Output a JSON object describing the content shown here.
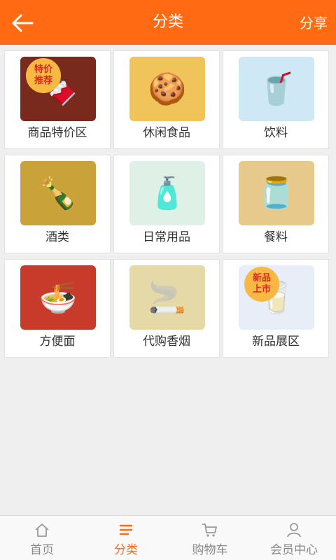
{
  "header": {
    "title": "分类",
    "share": "分享"
  },
  "colors": {
    "accent": "#ff6a13"
  },
  "categories": [
    {
      "label": "商品特价区",
      "icon": "chocolate-icon",
      "badge": [
        "特价",
        "推荐"
      ],
      "bg": "#7a2a1c",
      "glyph": "🍫"
    },
    {
      "label": "休闲食品",
      "icon": "snacks-icon",
      "bg": "#f0c35b",
      "glyph": "🍪"
    },
    {
      "label": "饮料",
      "icon": "drinks-icon",
      "bg": "#cfe8f5",
      "glyph": "🥤"
    },
    {
      "label": "酒类",
      "icon": "liquor-icon",
      "bg": "#c9a23a",
      "glyph": "🍾"
    },
    {
      "label": "日常用品",
      "icon": "daily-goods-icon",
      "bg": "#dff1e6",
      "glyph": "🧴"
    },
    {
      "label": "餐料",
      "icon": "condiments-icon",
      "bg": "#e6c98b",
      "glyph": "🫙"
    },
    {
      "label": "方便面",
      "icon": "instant-noodles-icon",
      "bg": "#c83a2a",
      "glyph": "🍜"
    },
    {
      "label": "代购香烟",
      "icon": "cigarettes-icon",
      "bg": "#e5d9a8",
      "glyph": "🚬"
    },
    {
      "label": "新品展区",
      "icon": "new-products-icon",
      "badge": [
        "新品",
        "上市"
      ],
      "bg": "#e7eef7",
      "glyph": "🥛"
    }
  ],
  "tabs": [
    {
      "label": "首页",
      "icon": "home-icon"
    },
    {
      "label": "分类",
      "icon": "list-icon",
      "active": true
    },
    {
      "label": "购物车",
      "icon": "cart-icon"
    },
    {
      "label": "会员中心",
      "icon": "user-icon"
    }
  ]
}
